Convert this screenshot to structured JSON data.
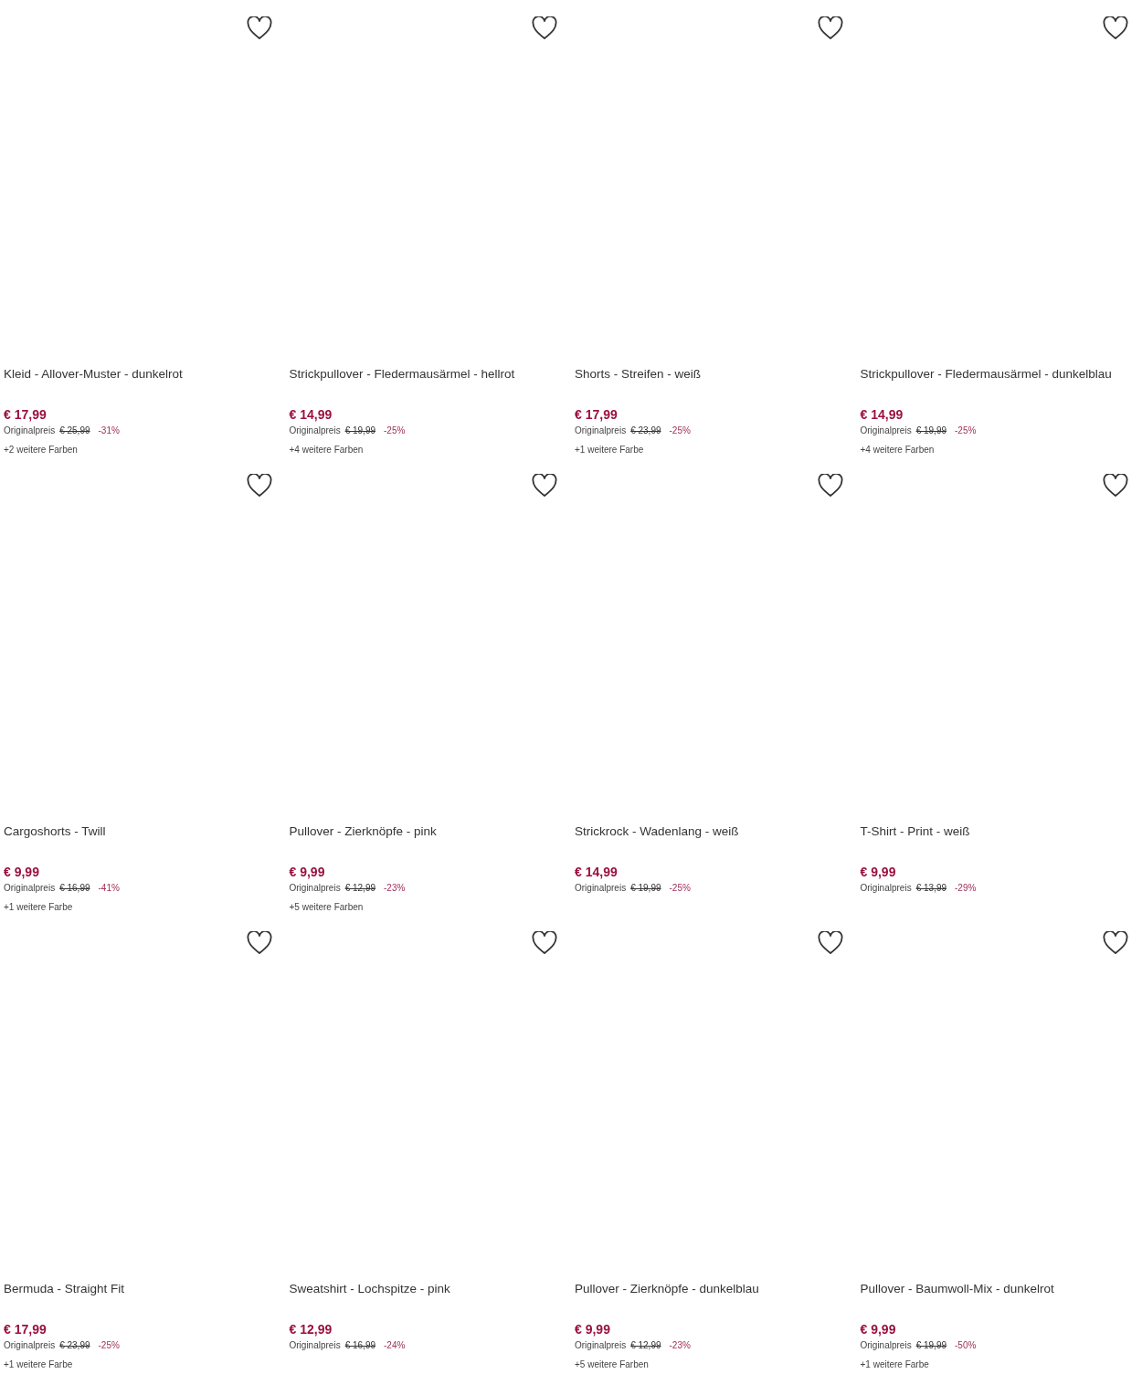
{
  "products": [
    {
      "title": "Kleid - Allover-Muster - dunkelrot",
      "price": "€ 17,99",
      "original_label": "Originalpreis",
      "original_price": "€ 25,99",
      "discount": "-31%",
      "colors": "+2 weitere Farben"
    },
    {
      "title": "Strickpullover - Fledermausärmel - hellrot",
      "price": "€ 14,99",
      "original_label": "Originalpreis",
      "original_price": "€ 19,99",
      "discount": "-25%",
      "colors": "+4 weitere Farben"
    },
    {
      "title": "Shorts - Streifen - weiß",
      "price": "€ 17,99",
      "original_label": "Originalpreis",
      "original_price": "€ 23,99",
      "discount": "-25%",
      "colors": "+1 weitere Farbe"
    },
    {
      "title": "Strickpullover - Fledermausärmel - dunkelblau",
      "price": "€ 14,99",
      "original_label": "Originalpreis",
      "original_price": "€ 19,99",
      "discount": "-25%",
      "colors": "+4 weitere Farben"
    },
    {
      "title": "Cargoshorts - Twill",
      "price": "€ 9,99",
      "original_label": "Originalpreis",
      "original_price": "€ 16,99",
      "discount": "-41%",
      "colors": "+1 weitere Farbe"
    },
    {
      "title": "Pullover - Zierknöpfe - pink",
      "price": "€ 9,99",
      "original_label": "Originalpreis",
      "original_price": "€ 12,99",
      "discount": "-23%",
      "colors": "+5 weitere Farben"
    },
    {
      "title": "Strickrock - Wadenlang - weiß",
      "price": "€ 14,99",
      "original_label": "Originalpreis",
      "original_price": "€ 19,99",
      "discount": "-25%"
    },
    {
      "title": "T-Shirt - Print - weiß",
      "price": "€ 9,99",
      "original_label": "Originalpreis",
      "original_price": "€ 13,99",
      "discount": "-29%"
    },
    {
      "title": "Bermuda - Straight Fit",
      "price": "€ 17,99",
      "original_label": "Originalpreis",
      "original_price": "€ 23,99",
      "discount": "-25%",
      "colors": "+1 weitere Farbe"
    },
    {
      "title": "Sweatshirt - Lochspitze - pink",
      "price": "€ 12,99",
      "original_label": "Originalpreis",
      "original_price": "€ 16,99",
      "discount": "-24%"
    },
    {
      "title": "Pullover - Zierknöpfe - dunkelblau",
      "price": "€ 9,99",
      "original_label": "Originalpreis",
      "original_price": "€ 12,99",
      "discount": "-23%",
      "colors": "+5 weitere Farben"
    },
    {
      "title": "Pullover - Baumwoll-Mix - dunkelrot",
      "price": "€ 9,99",
      "original_label": "Originalpreis",
      "original_price": "€ 19,99",
      "discount": "-50%",
      "colors": "+1 weitere Farbe"
    }
  ]
}
